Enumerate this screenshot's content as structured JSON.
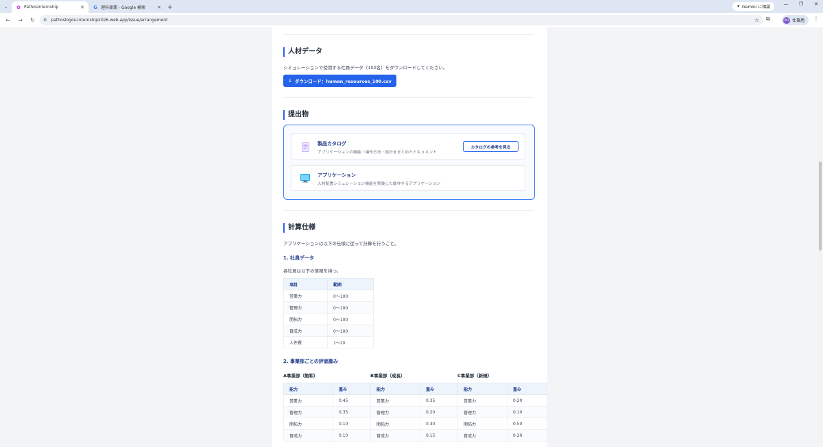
{
  "browser": {
    "tabs": [
      {
        "title": "PathosInternship",
        "active": true
      },
      {
        "title": "理科學業 - Google 検索",
        "active": false
      }
    ],
    "new_tab": "+",
    "gemini_label": "Gemini に相談",
    "url": "pathoslogos-internship2026.web.app/issue/arrangement",
    "profile_name": "仕事用",
    "profile_initials": "PAT"
  },
  "hr_section": {
    "heading": "人材データ",
    "description": "シミュレーションで使用する社員データ（100名）をダウンロードしてください。",
    "download_label": "ダウンロード：human_resources_100.csv"
  },
  "deliverables": {
    "heading": "提出物",
    "items": [
      {
        "title": "製品カタログ",
        "description": "アプリケーションの機能・操作方法・設計をまとめたドキュメント",
        "button": "カタログの参考を見る",
        "icon": "document-icon"
      },
      {
        "title": "アプリケーション",
        "description": "人材配置シミュレーション機能を実装した動作するアプリケーション",
        "button": "",
        "icon": "monitor-icon"
      }
    ]
  },
  "spec": {
    "heading": "計算仕様",
    "intro": "アプリケーションは以下の仕様に従って計算を行うこと。",
    "s1_title": "1. 社員データ",
    "s1_desc": "各社員は以下の情報を持つ。",
    "table1": {
      "headers": [
        "項目",
        "範囲"
      ],
      "rows": [
        [
          "営業力",
          "0〜100"
        ],
        [
          "管理力",
          "0〜100"
        ],
        [
          "開拓力",
          "0〜100"
        ],
        [
          "育成力",
          "0〜100"
        ],
        [
          "人件費",
          "1〜20"
        ]
      ]
    },
    "s2_title": "2. 事業部ごとの評価重み",
    "divisions": [
      "A事業部（飽和）",
      "B事業部（成長）",
      "C事業部（新規）"
    ],
    "weights": {
      "headers": [
        "能力",
        "重み",
        "能力",
        "重み",
        "能力",
        "重み"
      ],
      "rows": [
        [
          "営業力",
          "0.45",
          "営業力",
          "0.35",
          "営業力",
          "0.20"
        ],
        [
          "管理力",
          "0.35",
          "管理力",
          "0.20",
          "管理力",
          "0.10"
        ],
        [
          "開拓力",
          "0.10",
          "開拓力",
          "0.30",
          "開拓力",
          "0.50"
        ],
        [
          "育成力",
          "0.10",
          "育成力",
          "0.15",
          "育成力",
          "0.20"
        ]
      ]
    }
  },
  "colors": {
    "accent": "#2563eb",
    "heading_blue": "#1e3a8a"
  }
}
